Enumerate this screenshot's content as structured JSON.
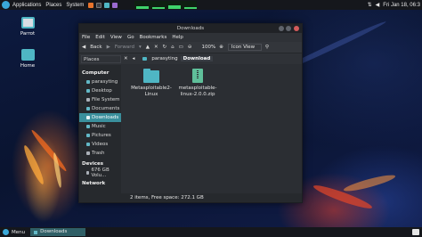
{
  "top_panel": {
    "menus": [
      "Applications",
      "Places",
      "System"
    ],
    "clock": "Fri Jan 18, 06:3",
    "tray_icons": [
      "network-icon",
      "volume-icon",
      "power-icon"
    ]
  },
  "desktop": {
    "icons": [
      {
        "label": "Parrot",
        "icon": "computer-icon"
      },
      {
        "label": "Home",
        "icon": "home-folder-icon"
      }
    ]
  },
  "window": {
    "title": "Downloads",
    "menu": [
      "File",
      "Edit",
      "View",
      "Go",
      "Bookmarks",
      "Help"
    ],
    "toolbar": {
      "back": "Back",
      "forward": "Forward",
      "zoom": "100%",
      "view_mode": "Icon View"
    },
    "location": {
      "places_label": "Places",
      "crumbs": [
        "parasyting",
        "Download"
      ]
    },
    "sidebar": {
      "sections": [
        {
          "title": "Computer",
          "items": [
            {
              "label": "parasyting",
              "icon": "home-icon"
            },
            {
              "label": "Desktop",
              "icon": "desktop-icon"
            },
            {
              "label": "File System",
              "icon": "drive-icon"
            },
            {
              "label": "Documents",
              "icon": "folder-icon"
            },
            {
              "label": "Downloads",
              "icon": "folder-icon",
              "selected": true
            },
            {
              "label": "Music",
              "icon": "folder-icon"
            },
            {
              "label": "Pictures",
              "icon": "folder-icon"
            },
            {
              "label": "Videos",
              "icon": "folder-icon"
            },
            {
              "label": "Trash",
              "icon": "trash-icon"
            }
          ]
        },
        {
          "title": "Devices",
          "items": [
            {
              "label": "676 GB Volu...",
              "icon": "drive-icon"
            }
          ]
        },
        {
          "title": "Network",
          "items": []
        }
      ]
    },
    "files": [
      {
        "name": "Metasploitable2-Linux",
        "line1": "Metasploitable2-",
        "line2": "Linux",
        "type": "folder"
      },
      {
        "name": "metasploitable-linux-2.0.0.zip",
        "line1": "metasploitable-",
        "line2": "linux-2.0.0.zip",
        "type": "zip"
      }
    ],
    "status": "2 items, Free space: 272.1 GB"
  },
  "bottom_panel": {
    "menu_label": "Menu",
    "task_label": "Downloads"
  },
  "colors": {
    "accent": "#3a8f9c",
    "panel": "#15171c",
    "window_bg": "#2b2e33"
  }
}
